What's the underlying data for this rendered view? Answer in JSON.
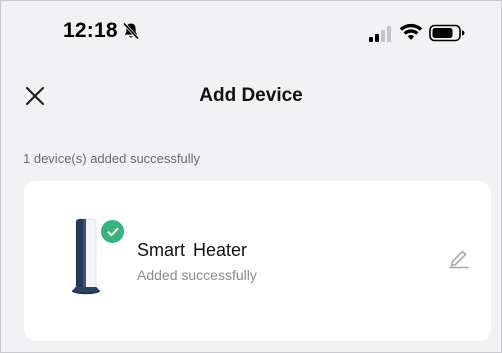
{
  "status_bar": {
    "time": "12:18",
    "icons": [
      "bell-slash-icon",
      "signal-icon",
      "wifi-icon",
      "battery-icon"
    ]
  },
  "header": {
    "title": "Add Device",
    "close_icon": "close-icon"
  },
  "summary": "1 device(s) added successfully",
  "devices": [
    {
      "name": "Smart  Heater",
      "status": "Added successfully",
      "badge_icon": "check-icon",
      "edit_icon": "edit-icon"
    }
  ],
  "colors": {
    "background": "#f2f2f4",
    "card": "#ffffff",
    "success_badge": "#36b37e",
    "secondary_text": "#8a8a8f"
  }
}
